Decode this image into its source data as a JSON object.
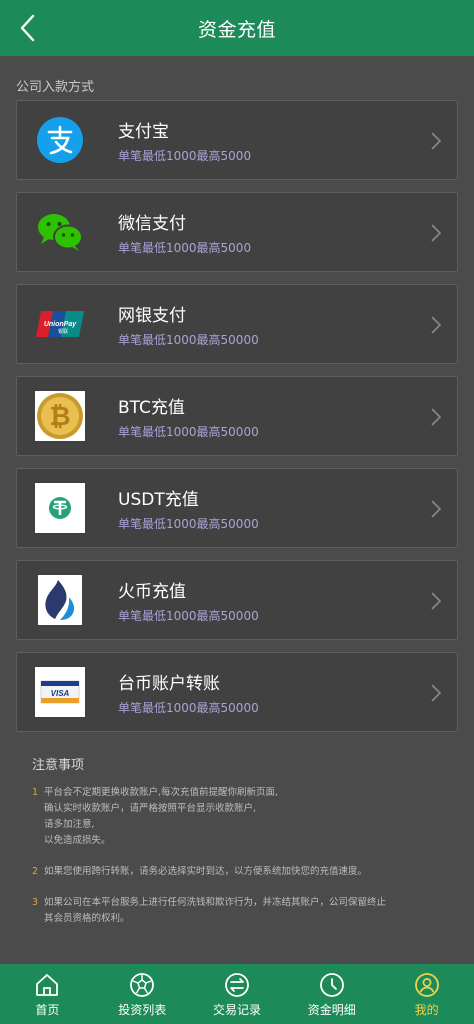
{
  "header": {
    "title": "资金充值",
    "back_icon": "chevron-left-icon"
  },
  "section_title": "公司入款方式",
  "methods": [
    {
      "name": "支付宝",
      "limit": "单笔最低1000最高5000",
      "icon": "alipay-icon"
    },
    {
      "name": "微信支付",
      "limit": "单笔最低1000最高5000",
      "icon": "wechat-icon"
    },
    {
      "name": "网银支付",
      "limit": "单笔最低1000最高50000",
      "icon": "unionpay-icon",
      "icon_text": "UnionPay 银联"
    },
    {
      "name": "BTC充值",
      "limit": "单笔最低1000最高50000",
      "icon": "bitcoin-icon"
    },
    {
      "name": "USDT充值",
      "limit": "单笔最低1000最高50000",
      "icon": "tether-icon"
    },
    {
      "name": "火币充值",
      "limit": "单笔最低1000最高50000",
      "icon": "huobi-icon"
    },
    {
      "name": "台币账户转账",
      "limit": "单笔最低1000最高50000",
      "icon": "visa-icon",
      "icon_text": "VISA"
    }
  ],
  "notes": {
    "title": "注意事项",
    "items": [
      {
        "num": "1",
        "lines": [
          "平台会不定期更换收款账户,每次充值前提醒你刷新页面,",
          "确认实时收款账户，请严格按照平台显示收款账户,",
          "请多加注意,",
          "以免造成损失。"
        ]
      },
      {
        "num": "2",
        "lines": [
          "如果您使用跨行转账，请务必选择实时到达，以方便系统加快您的充值速度。"
        ]
      },
      {
        "num": "3",
        "lines": [
          "如果公司在本平台服务上进行任何洗钱和欺诈行为，并冻结其账户，公司保留终止",
          "其会员资格的权利。"
        ]
      }
    ]
  },
  "tabbar": [
    {
      "label": "首页",
      "icon": "home-icon"
    },
    {
      "label": "投资列表",
      "icon": "soccer-ball-icon"
    },
    {
      "label": "交易记录",
      "icon": "exchange-icon"
    },
    {
      "label": "资金明细",
      "icon": "clock-icon"
    },
    {
      "label": "我的",
      "icon": "user-icon",
      "active": true
    }
  ],
  "colors": {
    "brand_green": "#1d8a5a",
    "active_tab": "#f1d34a",
    "limit_text": "#a9a3d6"
  }
}
